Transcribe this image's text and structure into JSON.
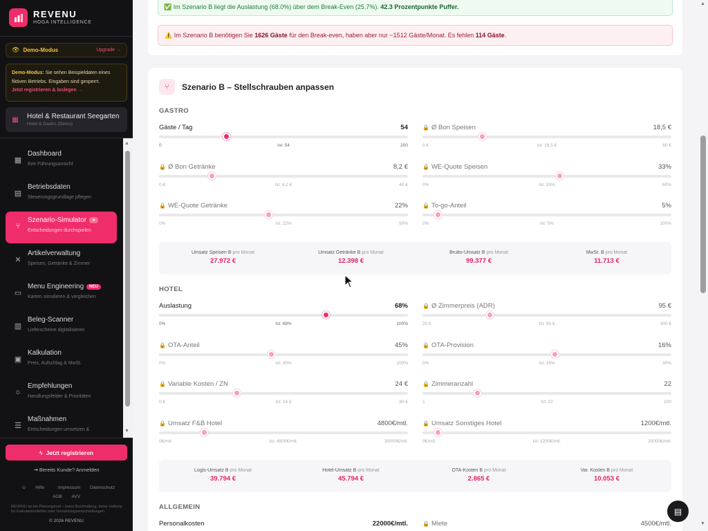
{
  "brand": {
    "name": "REVENU",
    "sub": "HOGA INTELLIGENCE"
  },
  "demo": {
    "label": "Demo-Modus",
    "upgrade": "Upgrade →",
    "bold": "Demo-Modus:",
    "text": " Sie sehen Beispieldaten eines fiktiven Betriebs. Eingaben sind gesperrt.",
    "link": "Jetzt registrieren & loslegen →"
  },
  "business": {
    "name": "Hotel & Restaurant Seegarten",
    "sub": "Hotel & Gastro (Demo)"
  },
  "nav": [
    {
      "label": "Dashboard",
      "sub": "Ihre Führungsansicht",
      "icon": "dashboard-icon"
    },
    {
      "label": "Betriebsdaten",
      "sub": "Steuerungsgrundlage pflegen",
      "icon": "clipboard-icon"
    },
    {
      "label": "Szenario-Simulator",
      "sub": "Entscheidungen durchspielen",
      "icon": "branch-icon",
      "badge": "★"
    },
    {
      "label": "Artikelverwaltung",
      "sub": "Speisen, Getränke & Zimmer",
      "icon": "utensils-icon"
    },
    {
      "label": "Menu Engineering",
      "sub": "Karten simulieren & vergleichen",
      "icon": "book-icon",
      "badge": "NEU"
    },
    {
      "label": "Beleg-Scanner",
      "sub": "Lieferscheine digitalisieren",
      "icon": "receipt-icon"
    },
    {
      "label": "Kalkulation",
      "sub": "Preis, Aufschlag & MwSt.",
      "icon": "calculator-icon"
    },
    {
      "label": "Empfehlungen",
      "sub": "Handlungsfelder & Prioritäten",
      "icon": "lightbulb-icon"
    },
    {
      "label": "Maßnahmen",
      "sub": "Entscheidungen umsetzen &",
      "icon": "checklist-icon"
    }
  ],
  "footer": {
    "register": "Jetzt registrieren",
    "login": "Bereits Kunde? Anmelden",
    "links": [
      "Hilfe",
      "Impressum",
      "Datenschutz",
      "AGB",
      "AVV"
    ],
    "disclaimer": "REVENU ist ein Planungstool – keine Buchhaltung, keine Haftung für Kalkulationsfehler oder Umsetzungsentscheidungen.",
    "copyright": "© 2026 REVENU"
  },
  "alerts": {
    "ok": {
      "pre": "✅ Im Szenario B liegt die Auslastung (68.0%) über dem Break-Even (25.7%). ",
      "bold": "42.3 Prozentpunkte Puffer."
    },
    "warn": {
      "p1": "⚠️ Im Szenario B benötigen Sie ",
      "b1": "1626 Gäste",
      "p2": " für den Break-even, haben aber nur ~1512 Gäste/Monat. Es fehlen ",
      "b2": "114 Gäste",
      "p3": "."
    }
  },
  "scenario": {
    "title": "Szenario B – Stellschrauben anpassen",
    "gastro": {
      "title": "GASTRO",
      "sliders": [
        {
          "label": "Gäste / Tag",
          "value": "54",
          "min": "0",
          "ist": "Ist: 54",
          "max": "200",
          "pos": 0.27,
          "locked": false
        },
        {
          "label": "Ø Bon Speisen",
          "value": "18,5 €",
          "min": "0 €",
          "ist": "Ist: 18,5 €",
          "max": "60 €",
          "pos": 0.24,
          "locked": true
        },
        {
          "label": "Ø Bon Getränke",
          "value": "8,2 €",
          "min": "0 €",
          "ist": "Ist: 8,2 €",
          "max": "40 €",
          "pos": 0.21,
          "locked": true
        },
        {
          "label": "WE-Quote Speisen",
          "value": "33%",
          "min": "0%",
          "ist": "Ist: 33%",
          "max": "60%",
          "pos": 0.55,
          "locked": true
        },
        {
          "label": "WE-Quote Getränke",
          "value": "22%",
          "min": "0%",
          "ist": "Ist: 22%",
          "max": "50%",
          "pos": 0.44,
          "locked": true
        },
        {
          "label": "To-go-Anteil",
          "value": "5%",
          "min": "0%",
          "ist": "Ist: 5%",
          "max": "100%",
          "pos": 0.06,
          "locked": true
        }
      ],
      "summary": [
        {
          "label": "Umsatz Speisen B",
          "pm": "pro Monat",
          "value": "27.972 €"
        },
        {
          "label": "Umsatz Getränke B",
          "pm": "pro Monat",
          "value": "12.398 €"
        },
        {
          "label": "Brutto-Umsatz B",
          "pm": "pro Monat",
          "value": "99.377 €"
        },
        {
          "label": "MwSt. B",
          "pm": "pro Monat",
          "value": "11.713 €"
        }
      ]
    },
    "hotel": {
      "title": "HOTEL",
      "sliders": [
        {
          "label": "Auslastung",
          "value": "68%",
          "min": "0%",
          "ist": "Ist: 68%",
          "max": "100%",
          "pos": 0.67,
          "locked": false
        },
        {
          "label": "Ø Zimmerpreis (ADR)",
          "value": "95 €",
          "min": "20 €",
          "ist": "Ist: 95 €",
          "max": "300 €",
          "pos": 0.27,
          "locked": true
        },
        {
          "label": "OTA-Anteil",
          "value": "45%",
          "min": "0%",
          "ist": "Ist: 45%",
          "max": "100%",
          "pos": 0.45,
          "locked": true
        },
        {
          "label": "OTA-Provision",
          "value": "16%",
          "min": "0%",
          "ist": "Ist: 16%",
          "max": "30%",
          "pos": 0.53,
          "locked": true
        },
        {
          "label": "Variable Kosten / ZN",
          "value": "24 €",
          "min": "0 €",
          "ist": "Ist: 24 €",
          "max": "80 €",
          "pos": 0.31,
          "locked": true
        },
        {
          "label": "Zimmeranzahl",
          "value": "22",
          "min": "1",
          "ist": "Ist: 22",
          "max": "100",
          "pos": 0.22,
          "locked": true
        },
        {
          "label": "Umsatz F&B Hotel",
          "value": "4800€/mtl.",
          "min": "0€/mtl.",
          "ist": "Ist: 4800€/mtl.",
          "max": "30000€/mtl.",
          "pos": 0.18,
          "locked": true
        },
        {
          "label": "Umsatz Sonstiges Hotel",
          "value": "1200€/mtl.",
          "min": "0€/mtl.",
          "ist": "Ist: 1200€/mtl.",
          "max": "20000€/mtl.",
          "pos": 0.06,
          "locked": true
        }
      ],
      "summary": [
        {
          "label": "Logis-Umsatz B",
          "pm": "pro Monat",
          "value": "39.794 €"
        },
        {
          "label": "Hotel-Umsatz B",
          "pm": "pro Monat",
          "value": "45.794 €"
        },
        {
          "label": "OTA-Kosten B",
          "pm": "pro Monat",
          "value": "2.865 €"
        },
        {
          "label": "Var. Kosten B",
          "pm": "pro Monat",
          "value": "10.053 €"
        }
      ]
    },
    "allgemein": {
      "title": "ALLGEMEIN",
      "rows": [
        {
          "label": "Personalkosten",
          "value": "22000€/mtl.",
          "locked": false
        },
        {
          "label": "Miete",
          "value": "4500€/mtl.",
          "locked": true
        }
      ]
    }
  },
  "colors": {
    "accent": "#ef2d6a",
    "sidebar": "#121214",
    "success": "#1f7a3a",
    "danger": "#a01b34"
  }
}
